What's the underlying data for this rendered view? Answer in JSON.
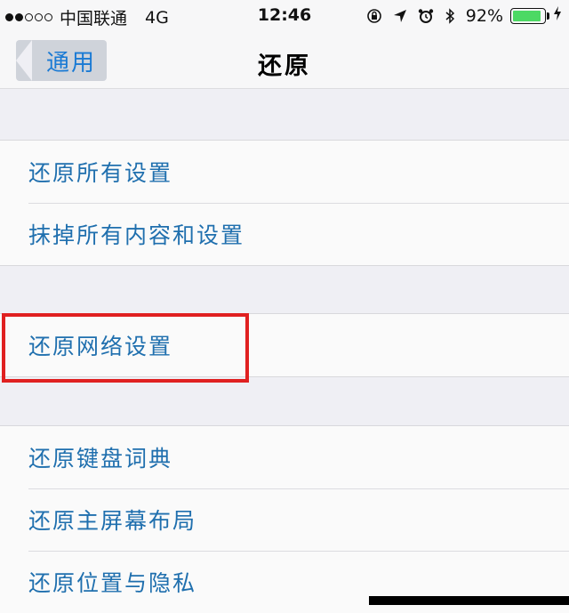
{
  "status_bar": {
    "carrier": "中国联通",
    "network": "4G",
    "time": "12:46",
    "battery_percent": "92%",
    "battery_level": 0.92,
    "icons": [
      "orientation-lock-icon",
      "location-arrow-icon",
      "alarm-icon",
      "bluetooth-icon",
      "battery-icon",
      "charging-icon"
    ],
    "signal_bars_filled": 2,
    "signal_bars_total": 5
  },
  "nav": {
    "back_label": "通用",
    "title": "还原"
  },
  "sections": [
    {
      "items": [
        "还原所有设置",
        "抹掉所有内容和设置"
      ]
    },
    {
      "items": [
        "还原网络设置"
      ],
      "highlighted": "还原网络设置"
    },
    {
      "items": [
        "还原键盘词典",
        "还原主屏幕布局",
        "还原位置与隐私"
      ]
    }
  ],
  "colors": {
    "link_blue": "#1f6fae",
    "highlight_red": "#e02020",
    "battery_green": "#4cd964",
    "background": "#efeff4"
  }
}
